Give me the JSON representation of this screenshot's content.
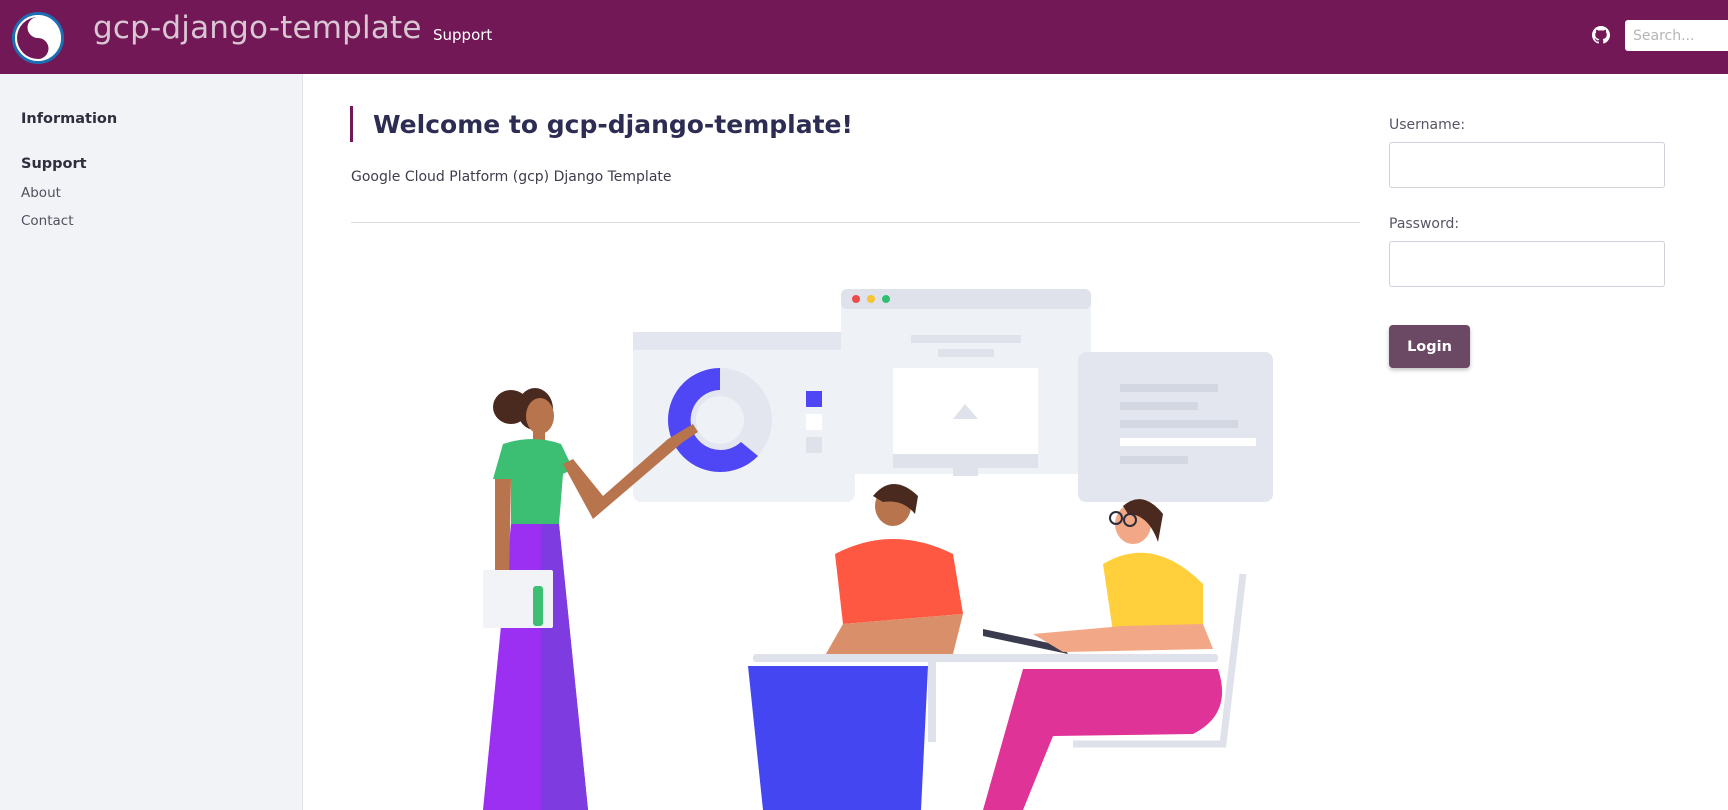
{
  "header": {
    "site_title": "gcp-django-template",
    "nav_support": "Support",
    "search_placeholder": "Search...",
    "bg_color": "#731856"
  },
  "sidebar": {
    "sections": [
      {
        "heading": "Information",
        "links": []
      },
      {
        "heading": "Support",
        "links": [
          "About",
          "Contact"
        ]
      }
    ]
  },
  "main": {
    "welcome_title": "Welcome to gcp-django-template!",
    "subtitle": "Google Cloud Platform (gcp) Django Template"
  },
  "login": {
    "username_label": "Username:",
    "password_label": "Password:",
    "button_label": "Login",
    "button_color": "#6b4863"
  },
  "icons": [
    "site-logo-icon",
    "github-icon"
  ]
}
